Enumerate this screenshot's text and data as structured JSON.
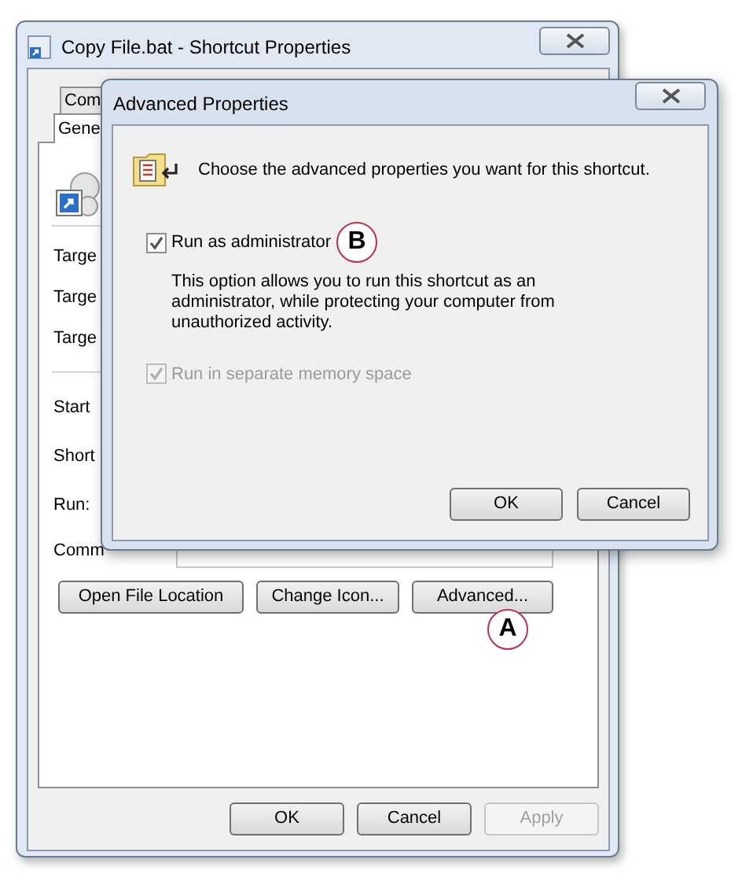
{
  "main_window": {
    "title": "Copy File.bat - Shortcut Properties",
    "tabs": [
      {
        "label": "Com",
        "selected": false
      },
      {
        "label": "Gene",
        "selected": true
      }
    ],
    "field_labels": [
      "Targe",
      "Targe",
      "Targe",
      "Start",
      "Short",
      "Run:",
      "Comm"
    ],
    "action_buttons": [
      {
        "label": "Open File Location",
        "disabled": false
      },
      {
        "label": "Change Icon...",
        "disabled": false
      },
      {
        "label": "Advanced...",
        "disabled": false
      }
    ],
    "dialog_buttons": [
      {
        "label": "OK",
        "disabled": false
      },
      {
        "label": "Cancel",
        "disabled": false
      },
      {
        "label": "Apply",
        "disabled": true
      }
    ]
  },
  "dialog": {
    "title": "Advanced Properties",
    "heading": "Choose the advanced properties you want for this shortcut.",
    "options": [
      {
        "label": "Run as administrator",
        "checked": true,
        "disabled": false,
        "description": "This option allows you to run this shortcut as an administrator, while protecting your computer from unauthorized activity."
      },
      {
        "label": "Run in separate memory space",
        "checked": true,
        "disabled": true
      }
    ],
    "buttons": [
      "OK",
      "Cancel"
    ]
  },
  "annotations": [
    {
      "label": "A"
    },
    {
      "label": "B"
    }
  ]
}
